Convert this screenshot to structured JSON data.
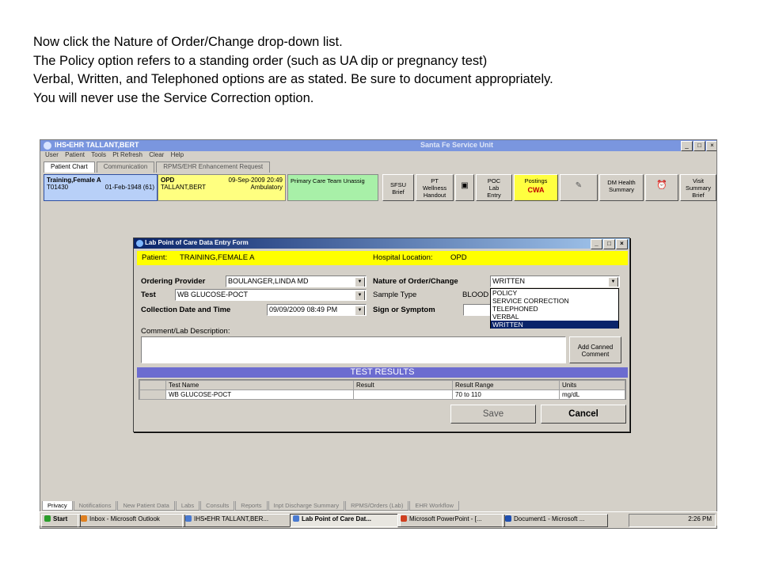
{
  "instructions": [
    "Now click the Nature of Order/Change drop-down list.",
    "The Policy option refers to a standing order (such as UA dip or pregnancy test)",
    "Verbal, Written, and Telephoned options are as stated. Be sure to document appropriately.",
    "You will never use the Service Correction option."
  ],
  "app": {
    "title": "IHS•EHR  TALLANT,BERT",
    "center_title": "Santa Fe Service Unit",
    "window_buttons": [
      "_",
      "□",
      "×"
    ],
    "menu": [
      "User",
      "Patient",
      "Tools",
      "Pt Refresh",
      "Clear",
      "Help"
    ],
    "top_tabs": [
      "Patient Chart",
      "Communication",
      "RPMS/EHR Enhancement Request"
    ],
    "patient": {
      "name": "Training,Female A",
      "id": "T01430",
      "dob": "01-Feb-1948 (61)"
    },
    "visit": {
      "location": "OPD",
      "datetime": "09-Sep-2009 20:49",
      "provider": "TALLANT,BERT",
      "type": "Ambulatory"
    },
    "care_team": "Primary Care Team Unassig",
    "toolbar": {
      "sfsu": "SFSU Brief",
      "pt_wellness": "PT Wellness Handout",
      "poc": "POC Lab Entry",
      "postings": "Postings",
      "cwa": "CWA",
      "dm": "DM Health Summary",
      "visit_summary": "Visit Summary Brief"
    },
    "bottom_tabs": [
      "Privacy",
      "Notifications",
      "New Patient Data",
      "Labs",
      "Consults",
      "Reports",
      "Inpt Discharge Summary",
      "RPMS/Orders (Lab)",
      "EHR Workflow"
    ]
  },
  "taskbar": {
    "start": "Start",
    "items": [
      "Inbox - Microsoft Outlook",
      "IHS•EHR  TALLANT,BER...",
      "Lab Point of Care Dat...",
      "Microsoft PowerPoint - [...",
      "Document1 - Microsoft ..."
    ],
    "clock": "2:26 PM"
  },
  "dialog": {
    "title": "Lab Point of Care Data Entry Form",
    "patient_label": "Patient:",
    "patient_value": "TRAINING,FEMALE A",
    "hospital_label": "Hospital Location:",
    "hospital_value": "OPD",
    "ordering_provider_label": "Ordering Provider",
    "ordering_provider_value": "BOULANGER,LINDA MD",
    "test_label": "Test",
    "test_value": "WB GLUCOSE-POCT",
    "collection_label": "Collection Date and Time",
    "collection_value": "09/09/2009 08:49 PM",
    "nature_label": "Nature of Order/Change",
    "nature_value": "WRITTEN",
    "nature_options": [
      "POLICY",
      "SERVICE CORRECTION",
      "TELEPHONED",
      "VERBAL",
      "WRITTEN"
    ],
    "sample_type_label": "Sample Type",
    "sample_type_value": "BLOOD",
    "sign_label": "Sign or Symptom",
    "comment_label": "Comment/Lab Description:",
    "add_canned": "Add Canned Comment",
    "results_header": "TEST RESULTS",
    "columns": [
      "Test Name",
      "Result",
      "Result Range",
      "Units"
    ],
    "row": [
      "WB GLUCOSE-POCT",
      "",
      "70 to 110",
      "mg/dL"
    ],
    "save": "Save",
    "cancel": "Cancel"
  }
}
